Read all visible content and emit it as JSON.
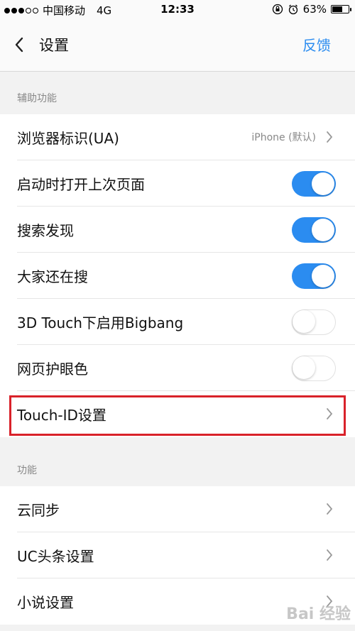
{
  "status_bar": {
    "carrier": "中国移动",
    "network": "4G",
    "time": "12:33",
    "battery": "63%",
    "battery_level": 0.63
  },
  "nav": {
    "title": "设置",
    "feedback": "反馈"
  },
  "sections": {
    "accessibility": {
      "header": "辅助功能",
      "items": [
        {
          "label": "浏览器标识(UA)",
          "value": "iPhone (默认)"
        },
        {
          "label": "启动时打开上次页面",
          "toggle": true
        },
        {
          "label": "搜索发现",
          "toggle": true
        },
        {
          "label": "大家还在搜",
          "toggle": true
        },
        {
          "label": "3D Touch下启用Bigbang",
          "toggle": false
        },
        {
          "label": "网页护眼色",
          "toggle": false
        },
        {
          "label": "Touch-ID设置"
        }
      ]
    },
    "features": {
      "header": "功能",
      "items": [
        {
          "label": "云同步"
        },
        {
          "label": "UC头条设置"
        },
        {
          "label": "小说设置"
        }
      ]
    }
  },
  "watermark": "Bai 经验",
  "colors": {
    "accent": "#2b8cf0",
    "highlight": "#d9222a"
  }
}
